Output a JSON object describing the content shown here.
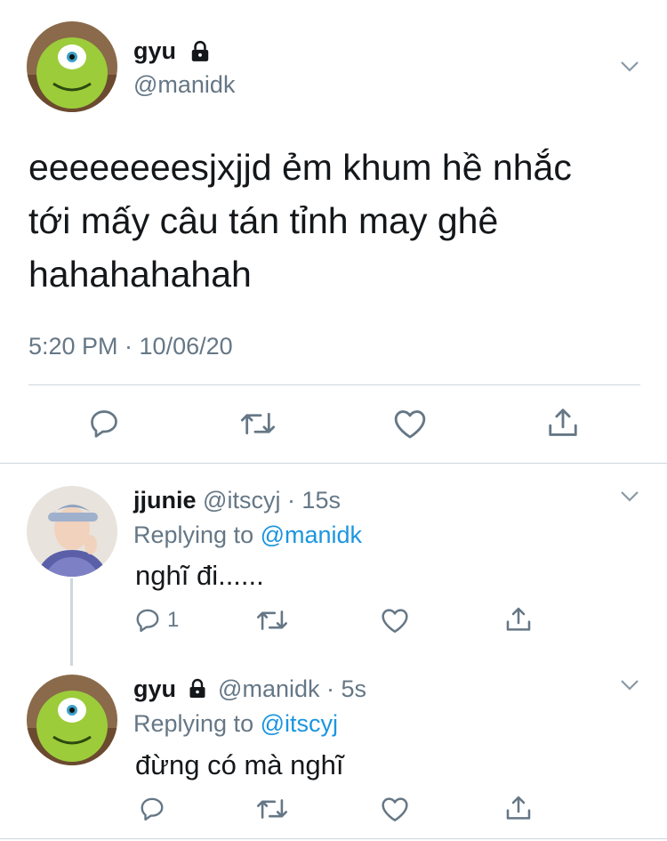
{
  "main_tweet": {
    "display_name": "gyu",
    "handle": "@manidk",
    "text": "eeeeeeeesjxjjd ẻm khum hề nhắc tới mấy câu tán tỉnh may ghê hahahahahah",
    "timestamp": "5:20 PM · 10/06/20"
  },
  "replies": [
    {
      "display_name": "jjunie",
      "handle_time": "@itscyj · 15s",
      "replying_prefix": "Replying to",
      "replying_to": "@manidk",
      "text": "nghĩ đi......",
      "reply_count": "1"
    },
    {
      "display_name": "gyu",
      "handle_time": "@manidk · 5s",
      "replying_prefix": "Replying to",
      "replying_to": "@itscyj",
      "text": "đừng có mà nghĩ"
    }
  ],
  "icons": [
    "lock-icon",
    "chevron-down-icon",
    "reply-icon",
    "retweet-icon",
    "like-icon",
    "share-icon"
  ],
  "colors": {
    "text": "#14171a",
    "muted": "#657786",
    "link": "#1b95e0",
    "divider": "#ccd6dd",
    "icon": "#657786"
  }
}
